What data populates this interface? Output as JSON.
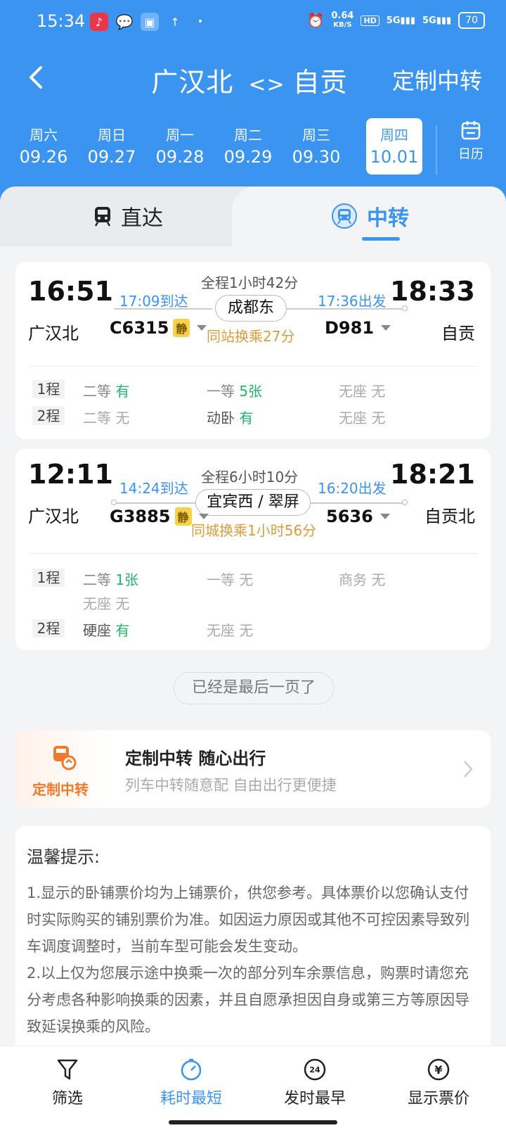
{
  "status_bar": {
    "time": "15:34",
    "speed_value": "0.64",
    "speed_unit": "KB/S",
    "battery": "70",
    "hd": "HD",
    "signal1": "5G",
    "signal2": "5G"
  },
  "nav": {
    "route_from": "广汉北",
    "route_sep": "<>",
    "route_to": "自贡",
    "custom_label": "定制中转"
  },
  "dates": [
    {
      "weekday": "周六",
      "date": "09.26"
    },
    {
      "weekday": "周日",
      "date": "09.27"
    },
    {
      "weekday": "周一",
      "date": "09.28"
    },
    {
      "weekday": "周二",
      "date": "09.29"
    },
    {
      "weekday": "周三",
      "date": "09.30"
    },
    {
      "weekday": "周四",
      "date": "10.01",
      "selected": true
    }
  ],
  "calendar_label": "日历",
  "tabs": {
    "direct": "直达",
    "transfer": "中转"
  },
  "results": [
    {
      "dep_time": "16:51",
      "dep_station": "广汉北",
      "arr_time": "18:33",
      "arr_station": "自贡",
      "arrive_mid": "17:09到达",
      "depart_mid": "17:36出发",
      "duration": "全程1小时42分",
      "transfer_station": "成都东",
      "transfer_note": "同站换乘27分",
      "train1": "C6315",
      "train1_quiet": "静",
      "train2": "D981",
      "seats": [
        {
          "leg": "1程",
          "items": [
            [
              "二等",
              "有"
            ],
            [
              "一等",
              "5张"
            ],
            [
              "无座",
              "无"
            ]
          ]
        },
        {
          "leg": "2程",
          "items": [
            [
              "二等",
              "无"
            ],
            [
              "动卧",
              "有"
            ],
            [
              "无座",
              "无"
            ]
          ]
        }
      ]
    },
    {
      "dep_time": "12:11",
      "dep_station": "广汉北",
      "arr_time": "18:21",
      "arr_station": "自贡北",
      "arrive_mid": "14:24到达",
      "depart_mid": "16:20出发",
      "duration": "全程6小时10分",
      "transfer_station": "宜宾西 / 翠屏",
      "transfer_note": "同城换乘1小时56分",
      "train1": "G3885",
      "train1_quiet": "静",
      "train2": "5636",
      "seats": [
        {
          "leg": "1程",
          "items": [
            [
              "二等",
              "1张"
            ],
            [
              "一等",
              "无"
            ],
            [
              "商务",
              "无"
            ],
            [
              "无座",
              "无"
            ]
          ]
        },
        {
          "leg": "2程",
          "items": [
            [
              "硬座",
              "有"
            ],
            [
              "无座",
              "无"
            ]
          ]
        }
      ]
    }
  ],
  "end_of_page": "已经是最后一页了",
  "promo": {
    "logo_label": "定制中转",
    "title": "定制中转 随心出行",
    "subtitle": "列车中转随意配 自由出行更便捷"
  },
  "tips": {
    "title": "温馨提示:",
    "p1": "1.显示的卧铺票价均为上铺票价，供您参考。具体票价以您确认支付时实际购买的铺别票价为准。如因运力原因或其他不可控因素导致列车调度调整时，当前车型可能会发生变动。",
    "p2": "2.以上仅为您展示途中换乘一次的部分列车余票信息，购票时请您充分考虑各种影响换乘的因素，并且自愿承担因自身或第三方等原因导致延误换乘的风险。"
  },
  "bottom_bar": [
    {
      "label": "筛选",
      "icon": "filter-icon"
    },
    {
      "label": "耗时最短",
      "icon": "timer-icon",
      "active": true
    },
    {
      "label": "发时最早",
      "icon": "clock-24-icon"
    },
    {
      "label": "显示票价",
      "icon": "yen-icon"
    }
  ],
  "colors": {
    "primary": "#3a94f0",
    "green": "#23b46c",
    "orange": "#e09a3a"
  }
}
